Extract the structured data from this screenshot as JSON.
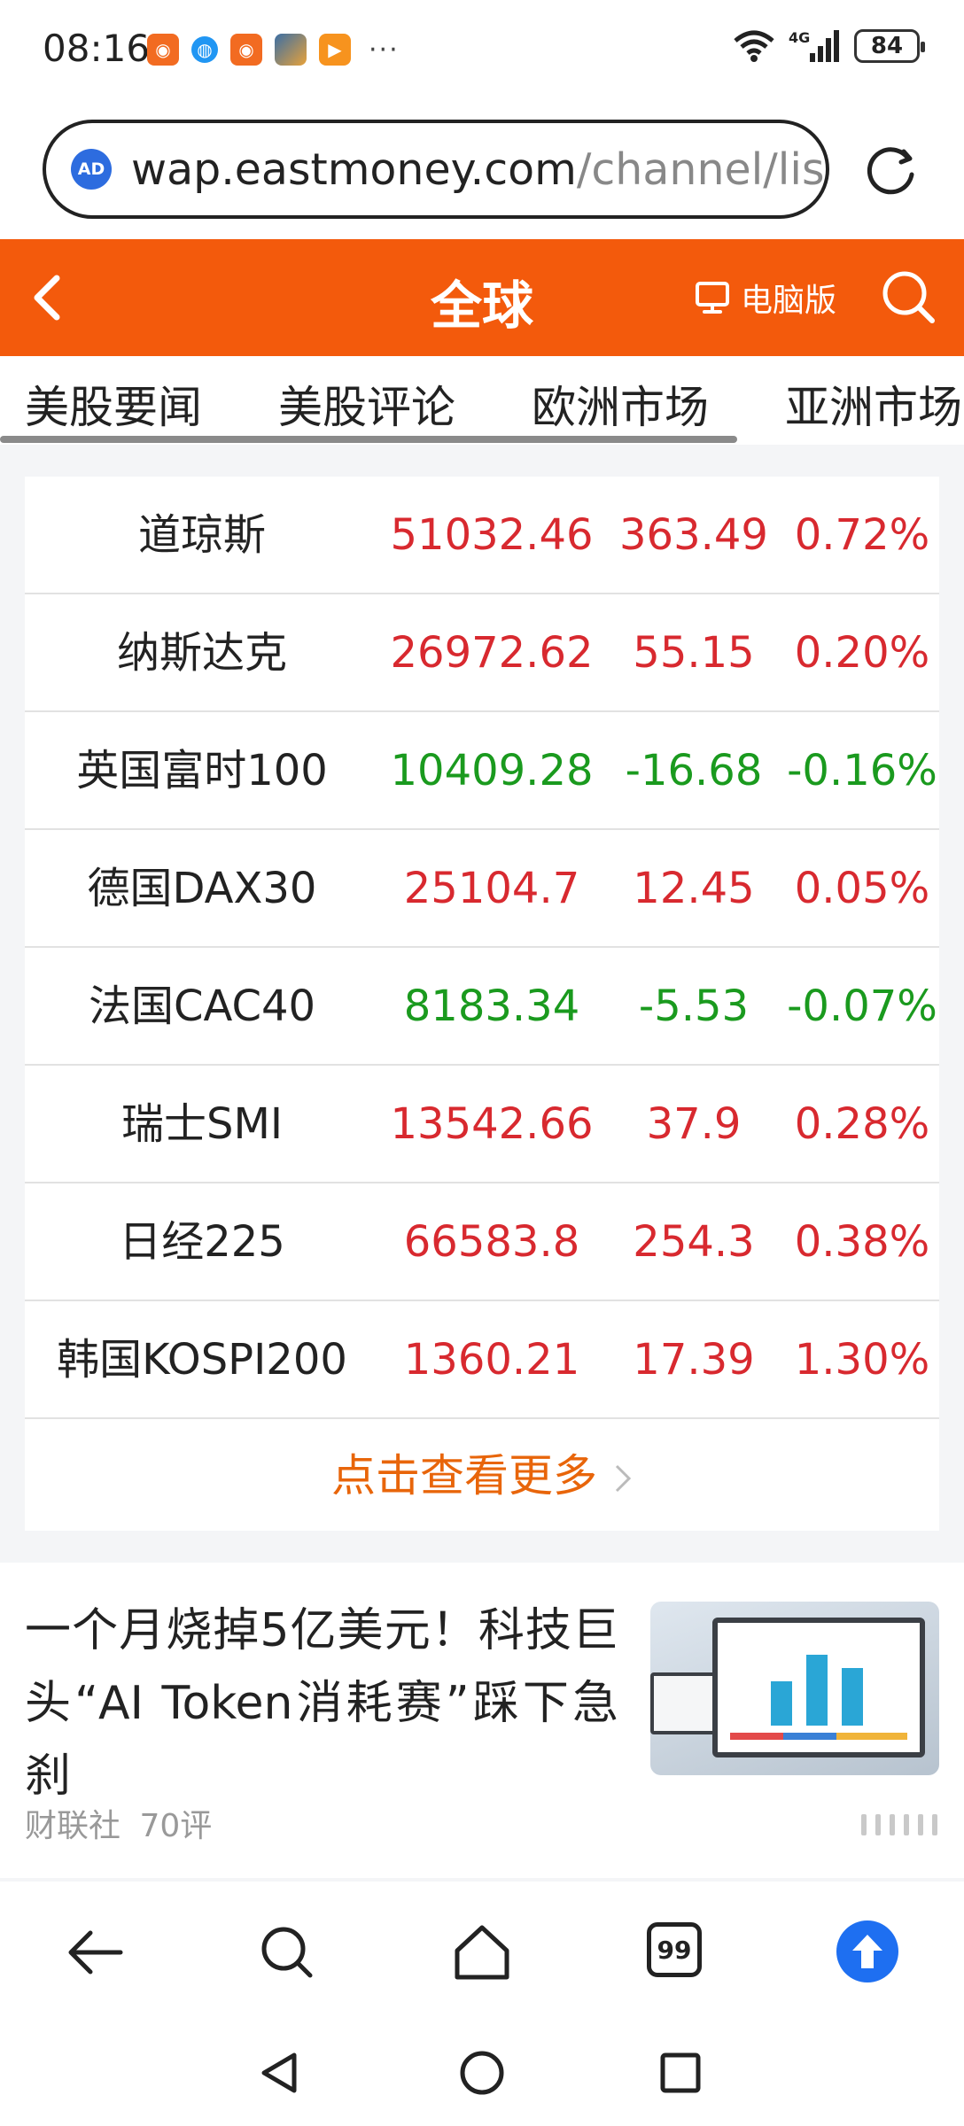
{
  "status_bar": {
    "time": "08:16",
    "notification_more": "···",
    "battery": "84",
    "network": "4G"
  },
  "browser": {
    "ad_badge": "AD",
    "url_main": "wap.eastmoney.com",
    "url_rest": "/channel/lis"
  },
  "header": {
    "title": "全球",
    "pc_version_label": "电脑版"
  },
  "tabs": [
    "美股要闻",
    "美股评论",
    "欧洲市场",
    "亚洲市场"
  ],
  "indices": [
    {
      "name": "道琼斯",
      "price": "51032.46",
      "change": "363.49",
      "percent": "0.72%",
      "trend": "up"
    },
    {
      "name": "纳斯达克",
      "price": "26972.62",
      "change": "55.15",
      "percent": "0.20%",
      "trend": "up"
    },
    {
      "name": "英国富时100",
      "price": "10409.28",
      "change": "-16.68",
      "percent": "-0.16%",
      "trend": "down"
    },
    {
      "name": "德国DAX30",
      "price": "25104.7",
      "change": "12.45",
      "percent": "0.05%",
      "trend": "up"
    },
    {
      "name": "法国CAC40",
      "price": "8183.34",
      "change": "-5.53",
      "percent": "-0.07%",
      "trend": "down"
    },
    {
      "name": "瑞士SMI",
      "price": "13542.66",
      "change": "37.9",
      "percent": "0.28%",
      "trend": "up"
    },
    {
      "name": "日经225",
      "price": "66583.8",
      "change": "254.3",
      "percent": "0.38%",
      "trend": "up"
    },
    {
      "name": "韩国KOSPI200",
      "price": "1360.21",
      "change": "17.39",
      "percent": "1.30%",
      "trend": "up"
    }
  ],
  "more_link": "点击查看更多",
  "news": {
    "title": "一个月烧掉5亿美元！科技巨头“AI Token消耗赛”踩下急刹",
    "source": "财联社",
    "comments": "70评"
  },
  "browser_nav": {
    "tabs_count": "99"
  },
  "colors": {
    "brand_orange": "#f35a0c",
    "up_red": "#d8292f",
    "down_green": "#1a9a1e",
    "link_orange": "#e8650a",
    "upload_blue": "#1e6ff1"
  },
  "icons": [
    "back-chevron-icon",
    "monitor-icon",
    "search-icon",
    "reload-icon",
    "wifi-icon",
    "signal-icon",
    "battery-icon",
    "back-arrow-icon",
    "home-icon",
    "upload-arrow-icon",
    "triangle-back-icon",
    "circle-home-icon",
    "square-recents-icon"
  ]
}
